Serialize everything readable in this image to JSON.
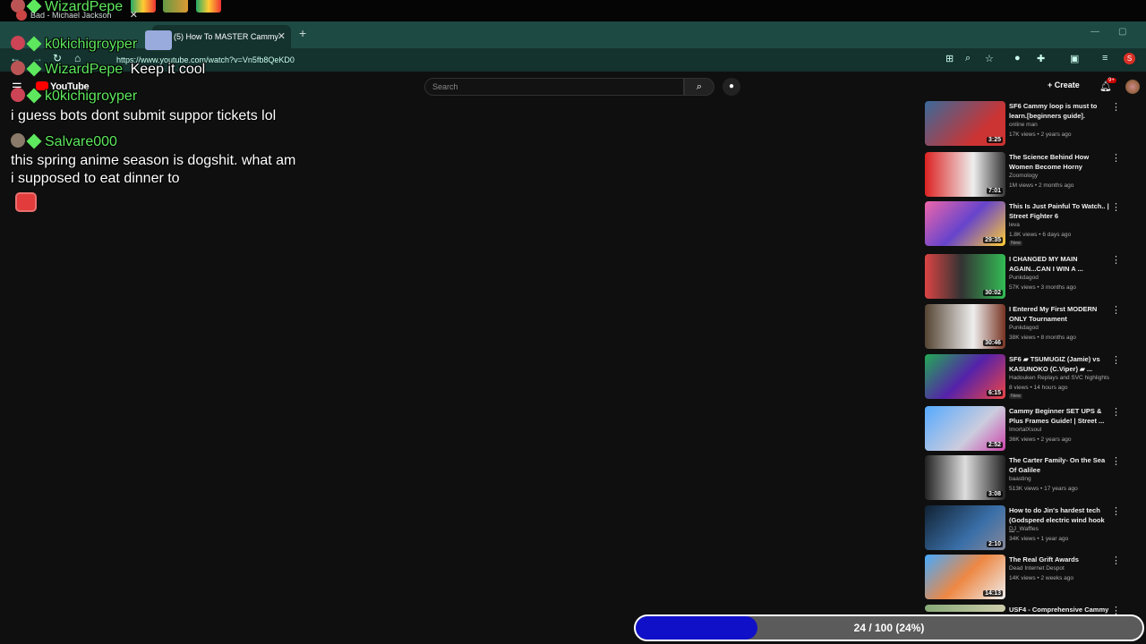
{
  "chat_top": {
    "name": "WizardPepe"
  },
  "browser": {
    "tabs": [
      {
        "label": "Bad - Michael Jackson",
        "active": false
      },
      {
        "label": "(5) How To MASTER Cammy",
        "active": true
      }
    ],
    "url": "https://www.youtube.com/watch?v=Vn5fb8QeKD0"
  },
  "youtube": {
    "logo": "YouTube",
    "search_placeholder": "Search",
    "create_label": "Create",
    "notif_badge": "9+"
  },
  "chat": [
    {
      "name": "k0kichigroyper",
      "message": ""
    },
    {
      "name": "WizardPepe",
      "message": "Keep it cool"
    },
    {
      "name": "k0kichigroyper",
      "message": "i guess bots dont submit suppor tickets lol"
    },
    {
      "name": "Salvare000",
      "message": "this spring anime season is dogshit. what am i supposed to eat dinner to"
    }
  ],
  "sidebar": [
    {
      "title": "SF6 Cammy loop is must to learn.[beginners guide].",
      "channel": "online man",
      "meta": "17K views • 2 years ago",
      "duration": "3:25",
      "badge": ""
    },
    {
      "title": "The Science Behind How Women Become Horny",
      "channel": "Zoomology",
      "meta": "1M views • 2 months ago",
      "duration": "7:01",
      "badge": ""
    },
    {
      "title": "This Is Just Painful To Watch.. | Street Fighter 6",
      "channel": "leva",
      "meta": "1.8K views • 6 days ago",
      "duration": "29:35",
      "badge": "New"
    },
    {
      "title": "I CHANGED MY MAIN AGAIN...CAN I WIN A ...",
      "channel": "Punkdagod",
      "meta": "57K views • 3 months ago",
      "duration": "30:02",
      "badge": ""
    },
    {
      "title": "I Entered My First MODERN ONLY Tournament",
      "channel": "Punkdagod",
      "meta": "38K views • 8 months ago",
      "duration": "30:46",
      "badge": ""
    },
    {
      "title": "SF6 ▰ TSUMUGIZ (Jamie) vs KASUNOKO (C.Viper) ▰ ...",
      "channel": "Hadouken Replays and SVC highlights",
      "meta": "8 views • 14 hours ago",
      "duration": "6:15",
      "badge": "New"
    },
    {
      "title": "Cammy Beginner SET UPS & Plus Frames Guide! | Street ...",
      "channel": "ImortalXsoul",
      "meta": "36K views • 2 years ago",
      "duration": "2:52",
      "badge": ""
    },
    {
      "title": "The Carter Family- On the Sea Of Galilee",
      "channel": "baasting",
      "meta": "513K views • 17 years ago",
      "duration": "3:08",
      "badge": ""
    },
    {
      "title": "How to do Jin's hardest tech (Godspeed electric wind hook ...",
      "channel": "DJ_Waffles",
      "meta": "34K views • 1 year ago",
      "duration": "2:10",
      "badge": ""
    },
    {
      "title": "The Real Grift Awards",
      "channel": "Dead Internet Despot",
      "meta": "14K views • 2 weeks ago",
      "duration": "14:13",
      "badge": ""
    },
    {
      "title": "USF4 - Comprehensive Cammy",
      "channel": "",
      "meta": "",
      "duration": "",
      "badge": ""
    }
  ],
  "progress": {
    "label": "24 / 100 (24%)",
    "value": 0.24
  },
  "colors": {
    "chat_name": "#5ee85e",
    "progress_fill": "#1010c8",
    "tab_bar": "#1e4a44"
  }
}
